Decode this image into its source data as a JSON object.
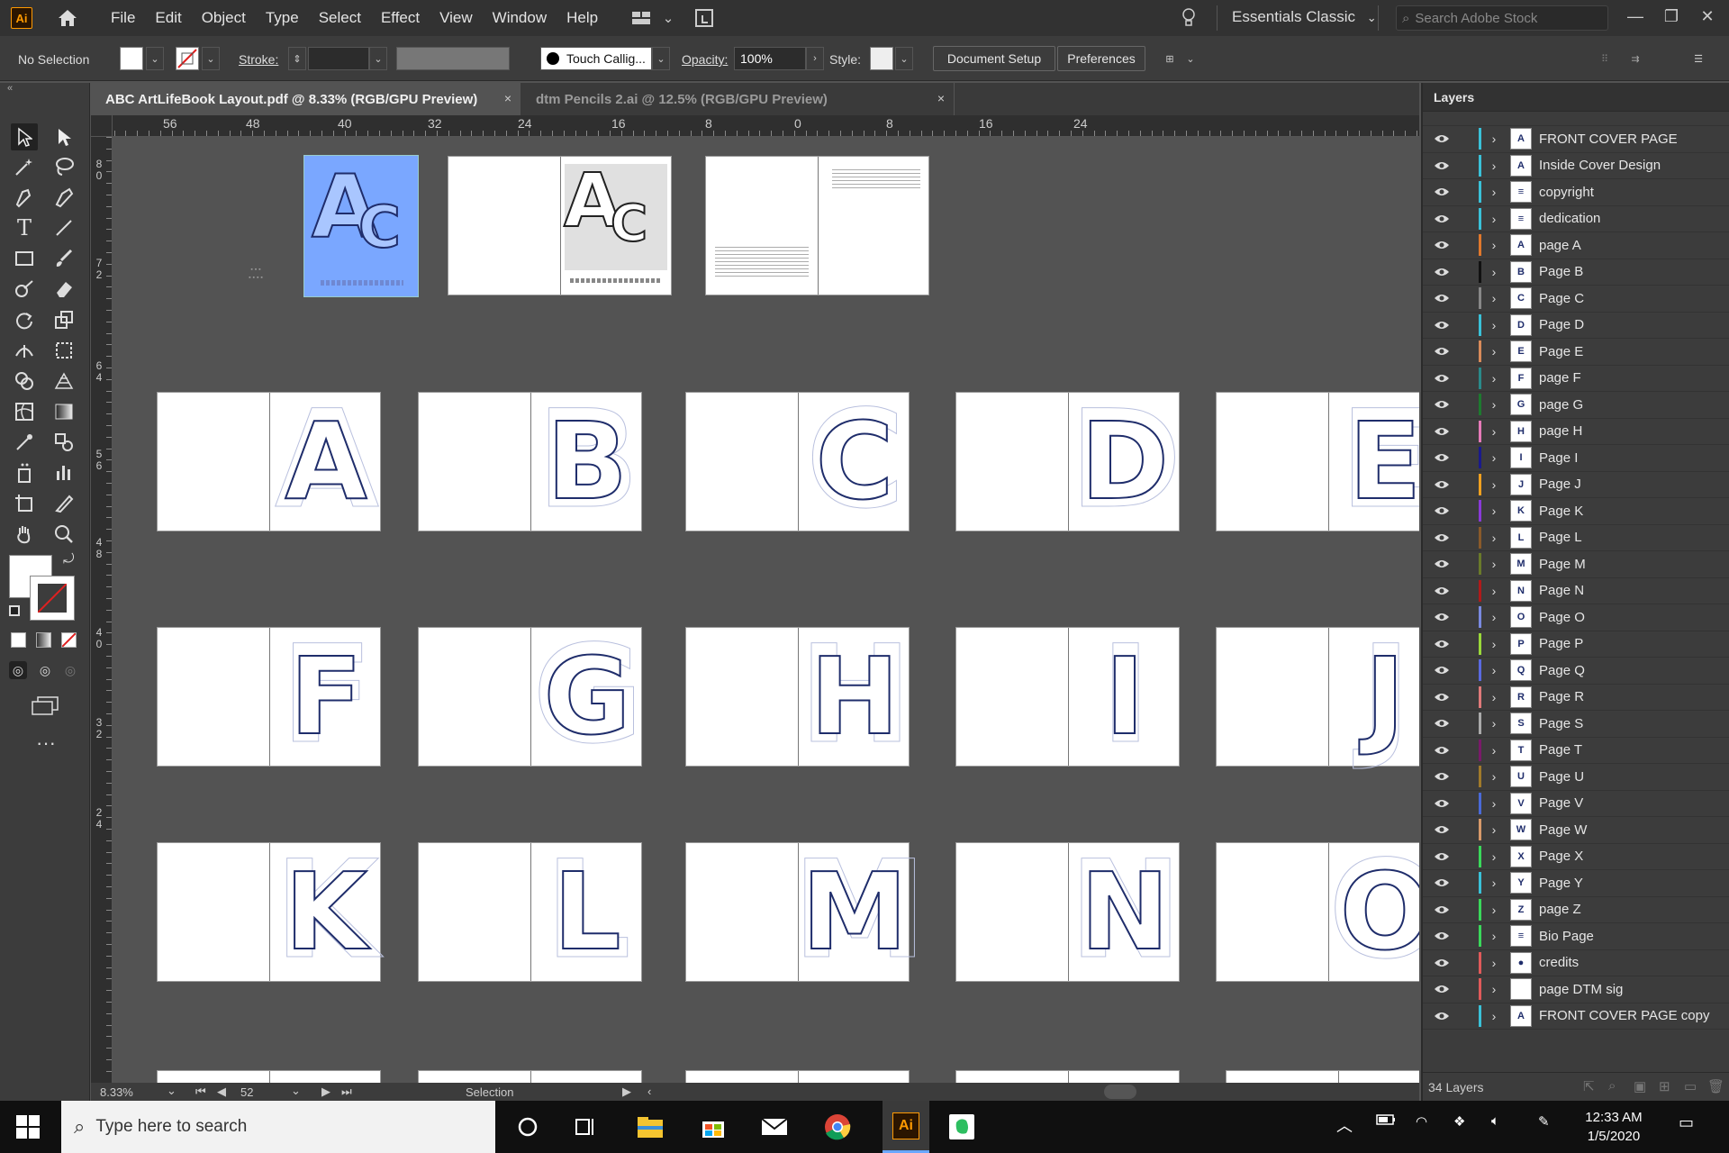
{
  "app": {
    "logo_text": "Ai"
  },
  "menu": [
    "File",
    "Edit",
    "Object",
    "Type",
    "Select",
    "Effect",
    "View",
    "Window",
    "Help"
  ],
  "workspace": {
    "label": "Essentials Classic"
  },
  "stock_search": {
    "placeholder": "Search Adobe Stock"
  },
  "control": {
    "selection": "No Selection",
    "stroke_label": "Stroke:",
    "brush": "Touch Callig...",
    "opacity_label": "Opacity:",
    "opacity_value": "100%",
    "style_label": "Style:",
    "document_setup": "Document Setup",
    "preferences": "Preferences"
  },
  "tabs": [
    {
      "label": "ABC ArtLifeBook Layout.pdf @ 8.33% (RGB/GPU Preview)",
      "close": "×"
    },
    {
      "label": "dtm Pencils 2.ai @ 12.5% (RGB/GPU Preview)",
      "close": "×"
    }
  ],
  "ruler_h": [
    "56",
    "48",
    "40",
    "32",
    "24",
    "16",
    "8",
    "0",
    "8",
    "16",
    "24"
  ],
  "ruler_v": [
    [
      "8",
      "0"
    ],
    [
      "7",
      "2"
    ],
    [
      "6",
      "4"
    ],
    [
      "5",
      "6"
    ],
    [
      "4",
      "8"
    ],
    [
      "4",
      "0"
    ],
    [
      "3",
      "2"
    ],
    [
      "2",
      "4"
    ]
  ],
  "status": {
    "zoom": "8.33%",
    "page": "52",
    "tool": "Selection"
  },
  "layers_panel": {
    "title": "Layers",
    "count": "34 Layers"
  },
  "layers": [
    {
      "name": "FRONT COVER PAGE",
      "color": "#3ac1d8",
      "thumb": "A"
    },
    {
      "name": "Inside Cover Design",
      "color": "#3ac1d8",
      "thumb": "A"
    },
    {
      "name": "copyright",
      "color": "#3ac1d8",
      "thumb": "≡"
    },
    {
      "name": "dedication",
      "color": "#3ac1d8",
      "thumb": "≡"
    },
    {
      "name": "page A",
      "color": "#e0782c",
      "thumb": "A"
    },
    {
      "name": "Page B",
      "color": "#111111",
      "thumb": "B"
    },
    {
      "name": "Page C",
      "color": "#888888",
      "thumb": "C"
    },
    {
      "name": "Page D",
      "color": "#3ac1d8",
      "thumb": "D"
    },
    {
      "name": "Page E",
      "color": "#d98b5a",
      "thumb": "E"
    },
    {
      "name": "page F",
      "color": "#2a8a8a",
      "thumb": "F"
    },
    {
      "name": "page G",
      "color": "#1e7a2f",
      "thumb": "G"
    },
    {
      "name": "page H",
      "color": "#e67ab8",
      "thumb": "H"
    },
    {
      "name": "Page I",
      "color": "#1a1a8c",
      "thumb": "I"
    },
    {
      "name": "Page J",
      "color": "#f0a020",
      "thumb": "J"
    },
    {
      "name": "Page K",
      "color": "#8a3ad8",
      "thumb": "K"
    },
    {
      "name": "Page L",
      "color": "#8a5a2a",
      "thumb": "L"
    },
    {
      "name": "Page M",
      "color": "#6a7a2a",
      "thumb": "M"
    },
    {
      "name": "Page N",
      "color": "#b01a1a",
      "thumb": "N"
    },
    {
      "name": "Page O",
      "color": "#7a8ae0",
      "thumb": "O"
    },
    {
      "name": "Page P",
      "color": "#9ad83a",
      "thumb": "P"
    },
    {
      "name": "Page Q",
      "color": "#5a6ae0",
      "thumb": "Q"
    },
    {
      "name": "Page R",
      "color": "#e07a7a",
      "thumb": "R"
    },
    {
      "name": "Page S",
      "color": "#aaaaaa",
      "thumb": "S"
    },
    {
      "name": "Page T",
      "color": "#7a1a6a",
      "thumb": "T"
    },
    {
      "name": "Page U",
      "color": "#a07a2a",
      "thumb": "U"
    },
    {
      "name": "Page V",
      "color": "#4a6ad8",
      "thumb": "V"
    },
    {
      "name": "Page W",
      "color": "#d89a6a",
      "thumb": "W"
    },
    {
      "name": "Page X",
      "color": "#3ad85a",
      "thumb": "X"
    },
    {
      "name": "Page Y",
      "color": "#3ac1d8",
      "thumb": "Y"
    },
    {
      "name": "page Z",
      "color": "#3ad85a",
      "thumb": "Z"
    },
    {
      "name": "Bio Page",
      "color": "#3ad85a",
      "thumb": "≡"
    },
    {
      "name": "credits",
      "color": "#e05a5a",
      "thumb": "●"
    },
    {
      "name": "page DTM sig",
      "color": "#e05a5a",
      "thumb": ""
    },
    {
      "name": "FRONT COVER PAGE copy",
      "color": "#3ac1d8",
      "thumb": "A"
    }
  ],
  "spreads": {
    "rows": [
      [
        "A",
        "B",
        "C",
        "D",
        "E"
      ],
      [
        "F",
        "G",
        "H",
        "I",
        "J"
      ],
      [
        "K",
        "L",
        "M",
        "N",
        "O"
      ]
    ]
  },
  "taskbar": {
    "search_placeholder": "Type here to search",
    "time": "12:33 AM",
    "date": "1/5/2020"
  }
}
